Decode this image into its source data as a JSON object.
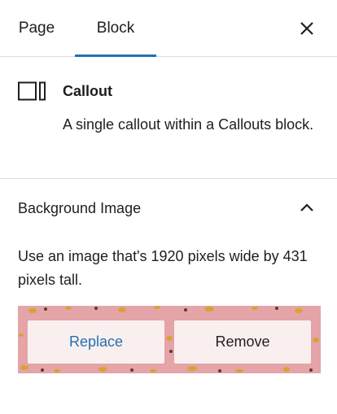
{
  "tabs": {
    "page_label": "Page",
    "block_label": "Block",
    "active": "Block"
  },
  "close_icon": "close-icon",
  "block_card": {
    "icon": "columns-block-icon",
    "title": "Callout",
    "description": "A single callout within a Callouts block."
  },
  "panel": {
    "title": "Background Image",
    "expanded": true,
    "chevron_icon": "chevron-up-icon",
    "help_text": "Use an image that's 1920 pixels wide by 431 pixels tall.",
    "replace_label": "Replace",
    "remove_label": "Remove"
  },
  "colors": {
    "accent": "#2271b1",
    "image_background": "#e4a4a8",
    "divider": "#dcdcde"
  }
}
